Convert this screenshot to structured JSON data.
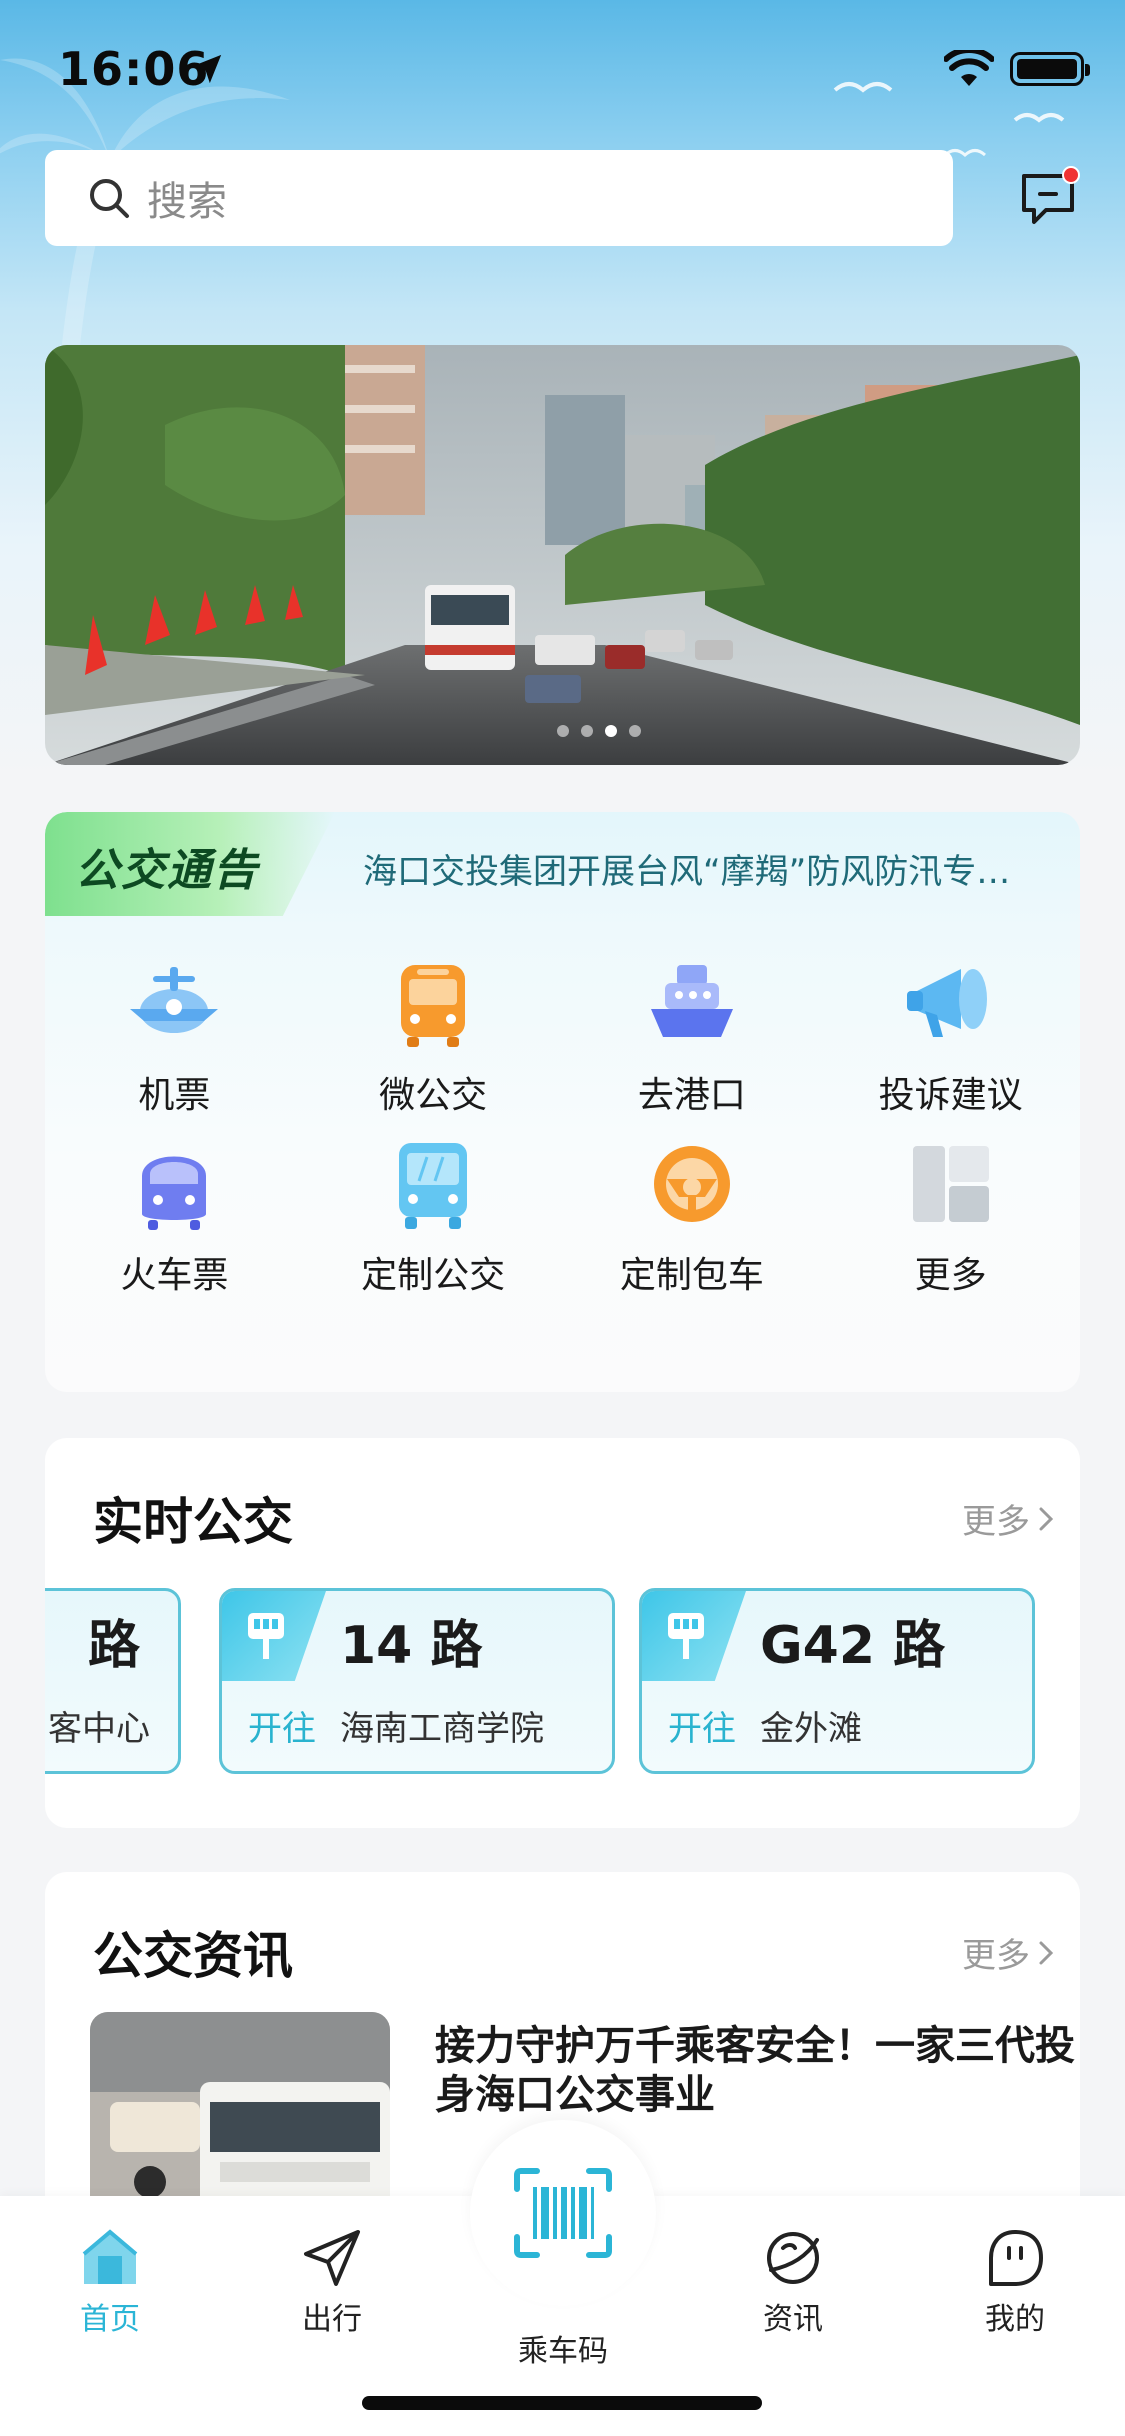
{
  "status_bar": {
    "time": "16:06"
  },
  "search": {
    "placeholder": "搜索"
  },
  "banner": {
    "dot_count": 4,
    "active_dot": 3
  },
  "notice": {
    "tag": "公交通告",
    "text": "海口交投集团开展台风“摩羯”防风防汛专…"
  },
  "services": [
    {
      "label": "机票",
      "icon": "plane-icon"
    },
    {
      "label": "微公交",
      "icon": "bus-icon"
    },
    {
      "label": "去港口",
      "icon": "ship-icon"
    },
    {
      "label": "投诉建议",
      "icon": "megaphone-icon"
    },
    {
      "label": "火车票",
      "icon": "train-icon"
    },
    {
      "label": "定制公交",
      "icon": "custom-bus-icon"
    },
    {
      "label": "定制包车",
      "icon": "steering-wheel-icon"
    },
    {
      "label": "更多",
      "icon": "grid-more-icon"
    }
  ],
  "realtime": {
    "title": "实时公交",
    "more": "更多",
    "routes": [
      {
        "name": "路",
        "to": "",
        "dest": "客中心"
      },
      {
        "name": "14 路",
        "to": "开往",
        "dest": "海南工商学院"
      },
      {
        "name": "G42 路",
        "to": "开往",
        "dest": "金外滩"
      }
    ]
  },
  "news": {
    "title": "公交资讯",
    "more": "更多",
    "items": [
      {
        "title": "接力守护万千乘客安全！一家三代投身海口公交事业"
      }
    ]
  },
  "tabbar": {
    "home": "首页",
    "trip": "出行",
    "scan": "乘车码",
    "info": "资讯",
    "mine": "我的"
  },
  "colors": {
    "accent": "#2bb5d6",
    "route_border": "#5cc3d8",
    "notice_green": "#7ee08e",
    "badge_red": "#f03434"
  }
}
